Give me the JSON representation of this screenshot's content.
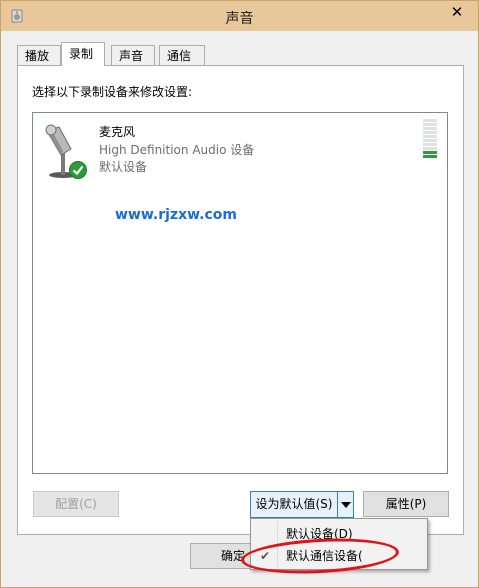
{
  "window": {
    "title": "声音",
    "close_glyph": "✕"
  },
  "tabs": [
    {
      "label": "播放",
      "active": false
    },
    {
      "label": "录制",
      "active": true
    },
    {
      "label": "声音",
      "active": false
    },
    {
      "label": "通信",
      "active": false
    }
  ],
  "instruction": "选择以下录制设备来修改设置:",
  "device": {
    "name": "麦克风",
    "description": "High Definition Audio 设备",
    "status": "默认设备",
    "icon": "microphone-icon",
    "status_icon": "green-check-icon",
    "level_bars_total": 10,
    "level_bars_lit": 2
  },
  "watermark": "www.rjzxw.com",
  "buttons": {
    "configure": "配置(C)",
    "set_default": "设为默认值(S)",
    "properties": "属性(P)",
    "ok": "确定"
  },
  "dropdown": {
    "items": [
      {
        "label": "默认设备(D)",
        "checked": false
      },
      {
        "label": "默认通信设备(",
        "checked": true
      }
    ]
  },
  "colors": {
    "titlebar": "#e8c79a",
    "accent_blue": "#3c7fb1",
    "highlight_red": "#e0131b",
    "check_green": "#2e9a3a"
  }
}
